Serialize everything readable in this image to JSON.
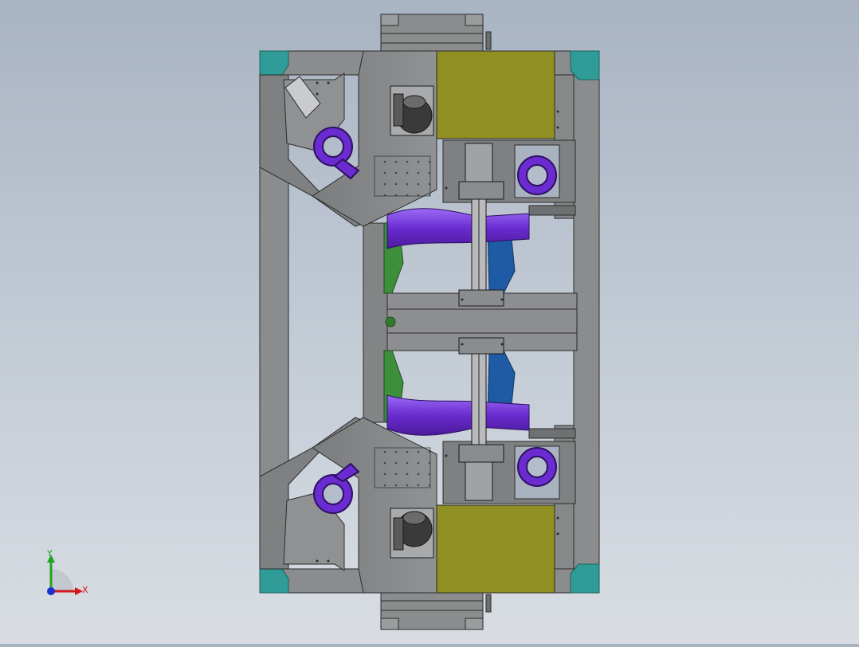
{
  "viewport": {
    "background_top": "#a9b4c3",
    "background_bottom": "#d9dde3"
  },
  "colors": {
    "frame_gray": "#8a8c8e",
    "plate_gray": "#7c7e80",
    "edge": "#2b2b2b",
    "teal_corner": "#2f9c97",
    "olive_box": "#8f8f22",
    "purple_pipe": "#6a2bd0",
    "purple_light": "#8f5cf0",
    "green_part": "#3e8f3c",
    "blue_part": "#1f5aa5",
    "motor_dark": "#3a3a3a"
  },
  "triad": {
    "x_label": "X",
    "y_label": "Y",
    "x_color": "#d01818",
    "y_color": "#1fa31f",
    "z_color": "#1a2fd0"
  }
}
